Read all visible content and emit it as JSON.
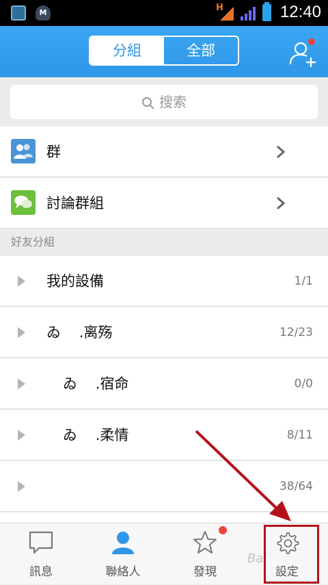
{
  "status_bar": {
    "time": "12:40",
    "network_type": "H",
    "icons": [
      "app-icon",
      "shield-m-icon",
      "signal-icon",
      "battery-icon"
    ]
  },
  "header": {
    "tabs": [
      {
        "label": "分組",
        "active": true
      },
      {
        "label": "全部",
        "active": false
      }
    ],
    "add_friend_icon": "add-contact-icon"
  },
  "search": {
    "placeholder": "搜索"
  },
  "groups": [
    {
      "label": "群",
      "icon": "group-icon",
      "icon_color": "#4a94d6"
    },
    {
      "label": "討論群組",
      "icon": "chat-bubbles-icon",
      "icon_color": "#6cbf3a"
    }
  ],
  "section_header": "好友分組",
  "friend_groups": [
    {
      "name": "我的設備",
      "count": "1/1"
    },
    {
      "name": "ゐ    .离殇",
      "count": "12/23"
    },
    {
      "name": "ゐ    .宿命",
      "count": "0/0"
    },
    {
      "name": "ゐ    .柔情",
      "count": "8/11"
    },
    {
      "name": "",
      "count": "38/64"
    }
  ],
  "bottom_nav": [
    {
      "label": "訊息",
      "icon": "message-icon"
    },
    {
      "label": "聯絡人",
      "icon": "contacts-icon",
      "active": true
    },
    {
      "label": "發現",
      "icon": "star-icon",
      "badge": true
    },
    {
      "label": "設定",
      "icon": "gear-icon"
    }
  ],
  "watermark": "Bai",
  "colors": {
    "accent": "#2f96e8",
    "badge": "#f0443a",
    "annotation": "#b3121a"
  }
}
